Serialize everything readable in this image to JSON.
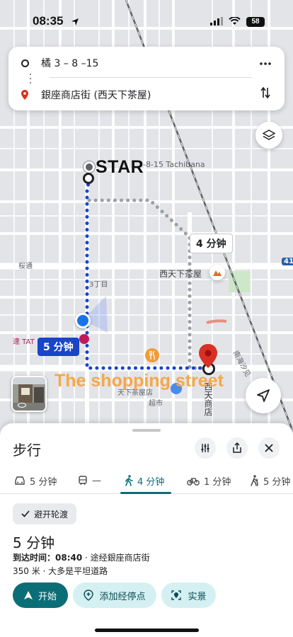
{
  "status_bar": {
    "time": "08:35",
    "battery": "58"
  },
  "route": {
    "origin": "橘 3 – 8 –15",
    "destination": "銀座商店街 (西天下茶屋)"
  },
  "map": {
    "chip_walk_time": "4 分钟",
    "chip_alt_time": "5 分钟",
    "labels": {
      "tachibana": "3-8-15 Tachibana",
      "station": "西天下茶屋",
      "sanchome": "3丁目",
      "sakuradori": "桜通",
      "tat": "達 TAT",
      "route41": "41",
      "shop": "天下茶屋店",
      "market": "超市",
      "street_vertical": "西天商店",
      "street_vertical2": "南海汐见"
    },
    "overlay_star": "STAR",
    "overlay_street": "The shopping street"
  },
  "sheet": {
    "title": "步行",
    "modes": [
      {
        "label": "5 分钟",
        "icon": "car-icon"
      },
      {
        "label": "—",
        "icon": "transit-icon"
      },
      {
        "label": "4 分钟",
        "icon": "walk-icon",
        "active": true
      },
      {
        "label": "1 分钟",
        "icon": "bike-icon"
      },
      {
        "label": "5 分钟",
        "icon": "hike-icon"
      }
    ],
    "ferry_chip": "避开轮渡",
    "duration": "5 分钟",
    "arrival_label": "到达时间：",
    "arrival_time": "08:40",
    "arrival_via": " · 途经銀座商店街",
    "distance": "350 米",
    "terrain": " · 大多是平坦道路",
    "buttons": {
      "start": "开始",
      "add_stop": "添加经停点",
      "street_view": "实景"
    }
  },
  "colors": {
    "accent": "#0b6e76",
    "route_blue": "#1a45c9",
    "pin_red": "#d93025"
  }
}
